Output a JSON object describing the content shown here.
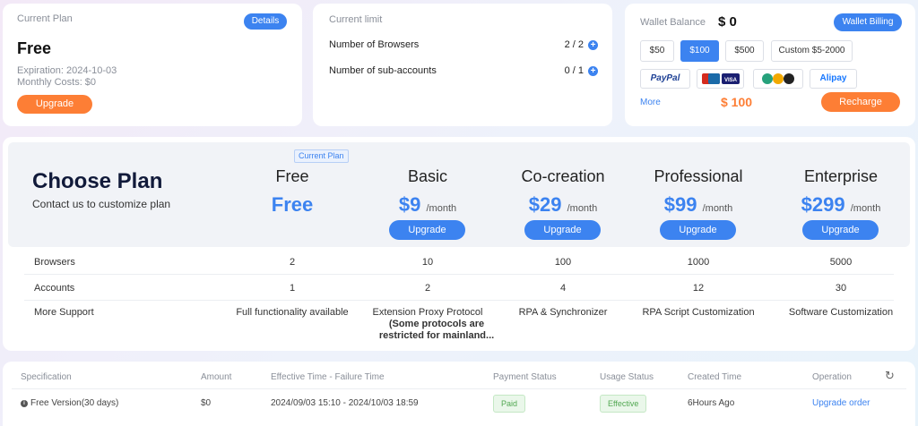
{
  "current_plan": {
    "heading": "Current Plan",
    "details_label": "Details",
    "plan_name": "Free",
    "expiration": "Expiration: 2024-10-03",
    "monthly_costs": "Monthly Costs: $0",
    "upgrade_label": "Upgrade"
  },
  "current_limit": {
    "heading": "Current limit",
    "rows": [
      {
        "label": "Number of Browsers",
        "value": "2 / 2"
      },
      {
        "label": "Number of sub-accounts",
        "value": "0 / 1"
      }
    ]
  },
  "wallet": {
    "label": "Wallet Balance",
    "balance": "$ 0",
    "billing_label": "Wallet Billing",
    "amounts": [
      "$50",
      "$100",
      "$500",
      "Custom $5-2000"
    ],
    "selected_amount": "$100",
    "payment_methods": [
      "PayPal",
      "UnionPay/VISA",
      "Crypto",
      "Alipay"
    ],
    "more_label": "More",
    "total": "$ 100",
    "recharge_label": "Recharge"
  },
  "choose_plan": {
    "title": "Choose Plan",
    "subtitle": "Contact us to customize plan",
    "current_badge": "Current Plan",
    "plans": [
      {
        "name": "Free",
        "price": "Free",
        "per": ""
      },
      {
        "name": "Basic",
        "price": "$9",
        "per": "/month",
        "button": "Upgrade"
      },
      {
        "name": "Co-creation",
        "price": "$29",
        "per": "/month",
        "button": "Upgrade"
      },
      {
        "name": "Professional",
        "price": "$99",
        "per": "/month",
        "button": "Upgrade"
      },
      {
        "name": "Enterprise",
        "price": "$299",
        "per": "/month",
        "button": "Upgrade"
      }
    ],
    "features": [
      {
        "label": "Browsers",
        "values": [
          "2",
          "10",
          "100",
          "1000",
          "5000"
        ]
      },
      {
        "label": "Accounts",
        "values": [
          "1",
          "2",
          "4",
          "12",
          "30"
        ]
      },
      {
        "label": "More Support",
        "values": [
          "Full functionality available",
          "Extension Proxy Protocol",
          "RPA & Synchronizer",
          "RPA Script Customization",
          "Software Customization"
        ]
      }
    ],
    "basic_note": "(Some protocols are restricted for mainland..."
  },
  "orders": {
    "columns": [
      "Specification",
      "Amount",
      "Effective Time - Failure Time",
      "Payment Status",
      "Usage Status",
      "Created Time",
      "Operation"
    ],
    "rows": [
      {
        "spec": "Free Version(30 days)",
        "amount": "$0",
        "time_range": "2024/09/03 15:10 - 2024/10/03 18:59",
        "payment_status": "Paid",
        "usage_status": "Effective",
        "created": "6Hours Ago",
        "operation": "Upgrade order"
      }
    ]
  },
  "colors": {
    "accent": "#3c83f0",
    "orange": "#fd7e35",
    "paid_bg": "#eaf7ea",
    "paid_text": "#52a852"
  }
}
